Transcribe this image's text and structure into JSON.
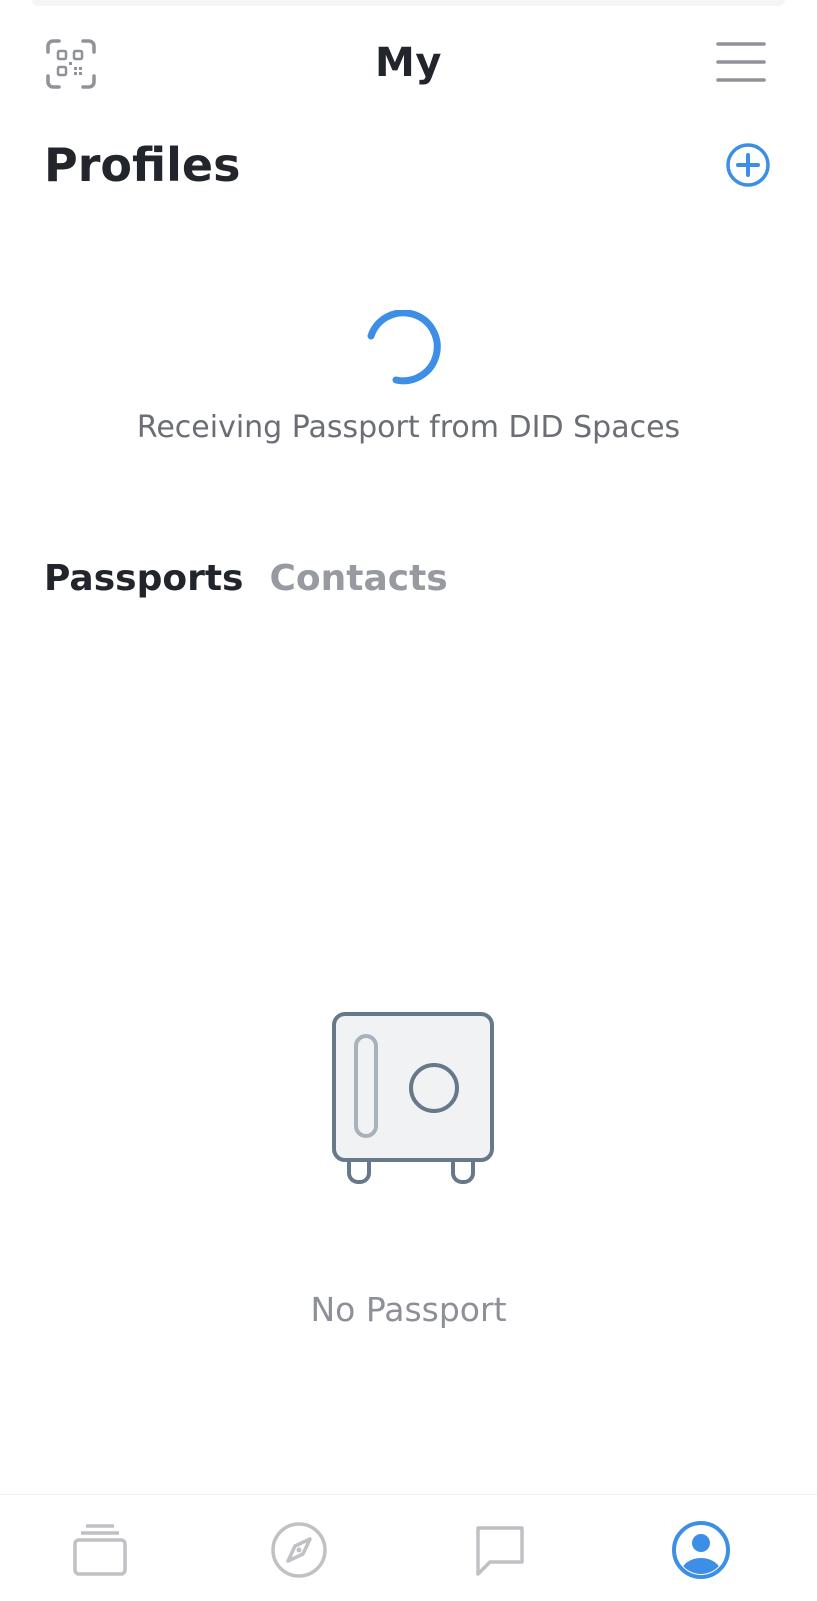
{
  "header": {
    "title": "My",
    "scan_icon": "qr-scan-icon",
    "menu_icon": "hamburger-menu-icon"
  },
  "profiles": {
    "heading": "Profiles",
    "add_icon": "plus-circle-icon",
    "loading_text": "Receiving Passport from DID Spaces"
  },
  "tabs": [
    {
      "label": "Passports",
      "active": true
    },
    {
      "label": "Contacts",
      "active": false
    }
  ],
  "empty_state": {
    "icon": "safe-icon",
    "text": "No Passport"
  },
  "bottom_nav": [
    {
      "icon": "cards-stack-icon",
      "active": false
    },
    {
      "icon": "compass-icon",
      "active": false
    },
    {
      "icon": "chat-bubble-icon",
      "active": false
    },
    {
      "icon": "user-profile-icon",
      "active": true
    }
  ],
  "colors": {
    "accent": "#3d8fe6",
    "text_primary": "#22252b",
    "text_muted": "#979aa1",
    "icon_gray": "#bfc1c5"
  }
}
